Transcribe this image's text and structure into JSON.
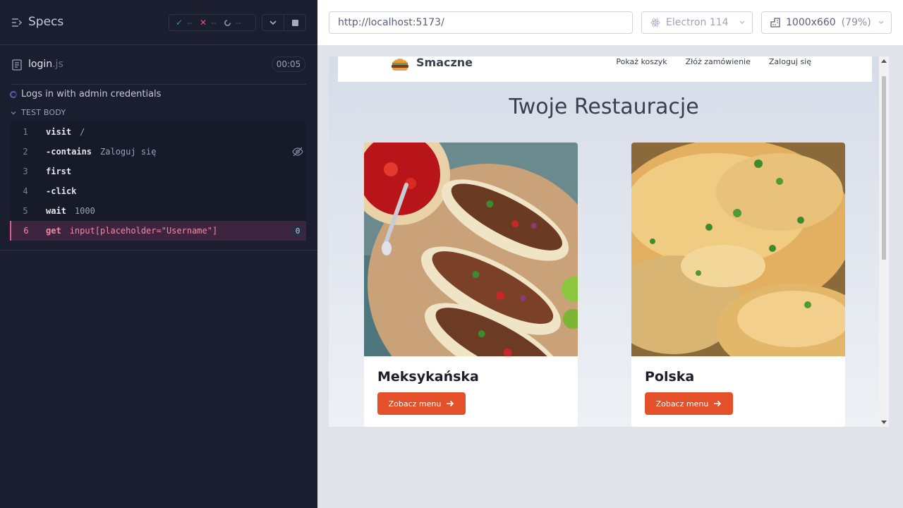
{
  "reporter": {
    "specs_label": "Specs",
    "stats": {
      "passed": "--",
      "failed": "--",
      "pending": "--"
    },
    "spec_file": {
      "name": "login",
      "ext": ".js",
      "duration": "00:05"
    },
    "test_title": "Logs in with admin credentials",
    "body_header": "TEST BODY",
    "commands": [
      {
        "num": "1",
        "name": "visit",
        "arg": "/"
      },
      {
        "num": "2",
        "name": "-contains",
        "arg": "Zaloguj się"
      },
      {
        "num": "3",
        "name": "first",
        "arg": ""
      },
      {
        "num": "4",
        "name": "-click",
        "arg": ""
      },
      {
        "num": "5",
        "name": "wait",
        "arg": "1000"
      },
      {
        "num": "6",
        "name": "get",
        "arg": "input[placeholder=\"Username\"]",
        "badge": "0"
      }
    ]
  },
  "browser": {
    "url": "http://localhost:5173/",
    "browser_name": "Electron 114",
    "viewport": "1000x660",
    "zoom": "(79%)"
  },
  "site": {
    "brand": "Smaczne",
    "nav": [
      "Pokaż koszyk",
      "Złóż zamówienie",
      "Zaloguj się"
    ],
    "heading": "Twoje Restauracje",
    "cards": [
      {
        "title": "Meksykańska",
        "button": "Zobacz menu"
      },
      {
        "title": "Polska",
        "button": "Zobacz menu"
      }
    ]
  },
  "colors": {
    "reporter_bg": "#1b1e2e",
    "active_command_bg": "#3d2540",
    "active_command_text": "#f08aa9",
    "cta_button": "#e4502a"
  }
}
